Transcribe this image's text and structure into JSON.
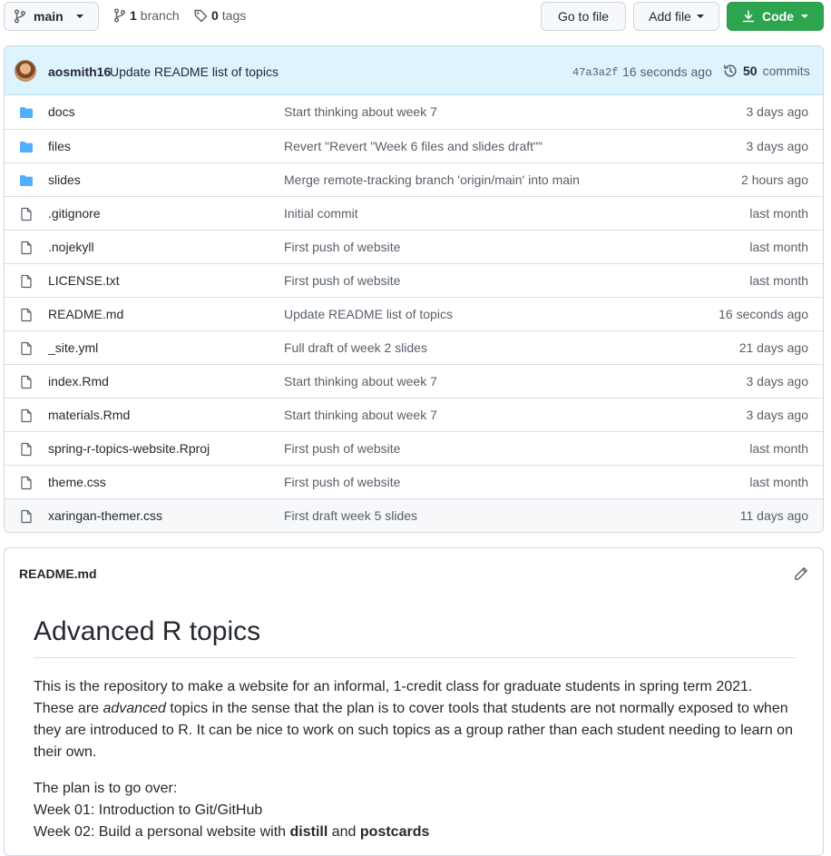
{
  "branch": {
    "name": "main",
    "count": "1",
    "count_label": "branch",
    "tags_count": "0",
    "tags_label": "tags"
  },
  "actions": {
    "go_to_file": "Go to file",
    "add_file": "Add file",
    "code": "Code"
  },
  "colors": {
    "accent_green": "#2da44e",
    "commit_bg": "#ddf4ff",
    "folder_blue": "#54aeff"
  },
  "latest_commit": {
    "author": "aosmith16",
    "message": "Update README list of topics",
    "sha": "47a3a2f",
    "time": "16 seconds ago",
    "count": "50",
    "count_label": "commits"
  },
  "files": [
    {
      "type": "folder",
      "name": "docs",
      "message": "Start thinking about week 7",
      "age": "3 days ago"
    },
    {
      "type": "folder",
      "name": "files",
      "message": "Revert \"Revert \"Week 6 files and slides draft\"\"",
      "age": "3 days ago"
    },
    {
      "type": "folder",
      "name": "slides",
      "message": "Merge remote-tracking branch 'origin/main' into main",
      "age": "2 hours ago"
    },
    {
      "type": "file",
      "name": ".gitignore",
      "message": "Initial commit",
      "age": "last month"
    },
    {
      "type": "file",
      "name": ".nojekyll",
      "message": "First push of website",
      "age": "last month"
    },
    {
      "type": "file",
      "name": "LICENSE.txt",
      "message": "First push of website",
      "age": "last month"
    },
    {
      "type": "file",
      "name": "README.md",
      "message": "Update README list of topics",
      "age": "16 seconds ago"
    },
    {
      "type": "file",
      "name": "_site.yml",
      "message": "Full draft of week 2 slides",
      "age": "21 days ago"
    },
    {
      "type": "file",
      "name": "index.Rmd",
      "message": "Start thinking about week 7",
      "age": "3 days ago"
    },
    {
      "type": "file",
      "name": "materials.Rmd",
      "message": "Start thinking about week 7",
      "age": "3 days ago"
    },
    {
      "type": "file",
      "name": "spring-r-topics-website.Rproj",
      "message": "First push of website",
      "age": "last month"
    },
    {
      "type": "file",
      "name": "theme.css",
      "message": "First push of website",
      "age": "last month"
    },
    {
      "type": "file",
      "name": "xaringan-themer.css",
      "message": "First draft week 5 slides",
      "age": "11 days ago"
    }
  ],
  "readme": {
    "filename": "README.md",
    "heading": "Advanced R topics",
    "intro_before": "This is the repository to make a website for an informal, 1-credit class for graduate students in spring term 2021. These are ",
    "intro_em": "advanced",
    "intro_after": " topics in the sense that the plan is to cover tools that students are not normally exposed to when they are introduced to R. It can be nice to work on such topics as a group rather than each student needing to learn on their own.",
    "plan_intro": "The plan is to go over:",
    "week01": "Week 01: Introduction to Git/GitHub",
    "week02_before": "Week 02: Build a personal website with ",
    "week02_b1": "distill",
    "week02_mid": " and ",
    "week02_b2": "postcards"
  }
}
